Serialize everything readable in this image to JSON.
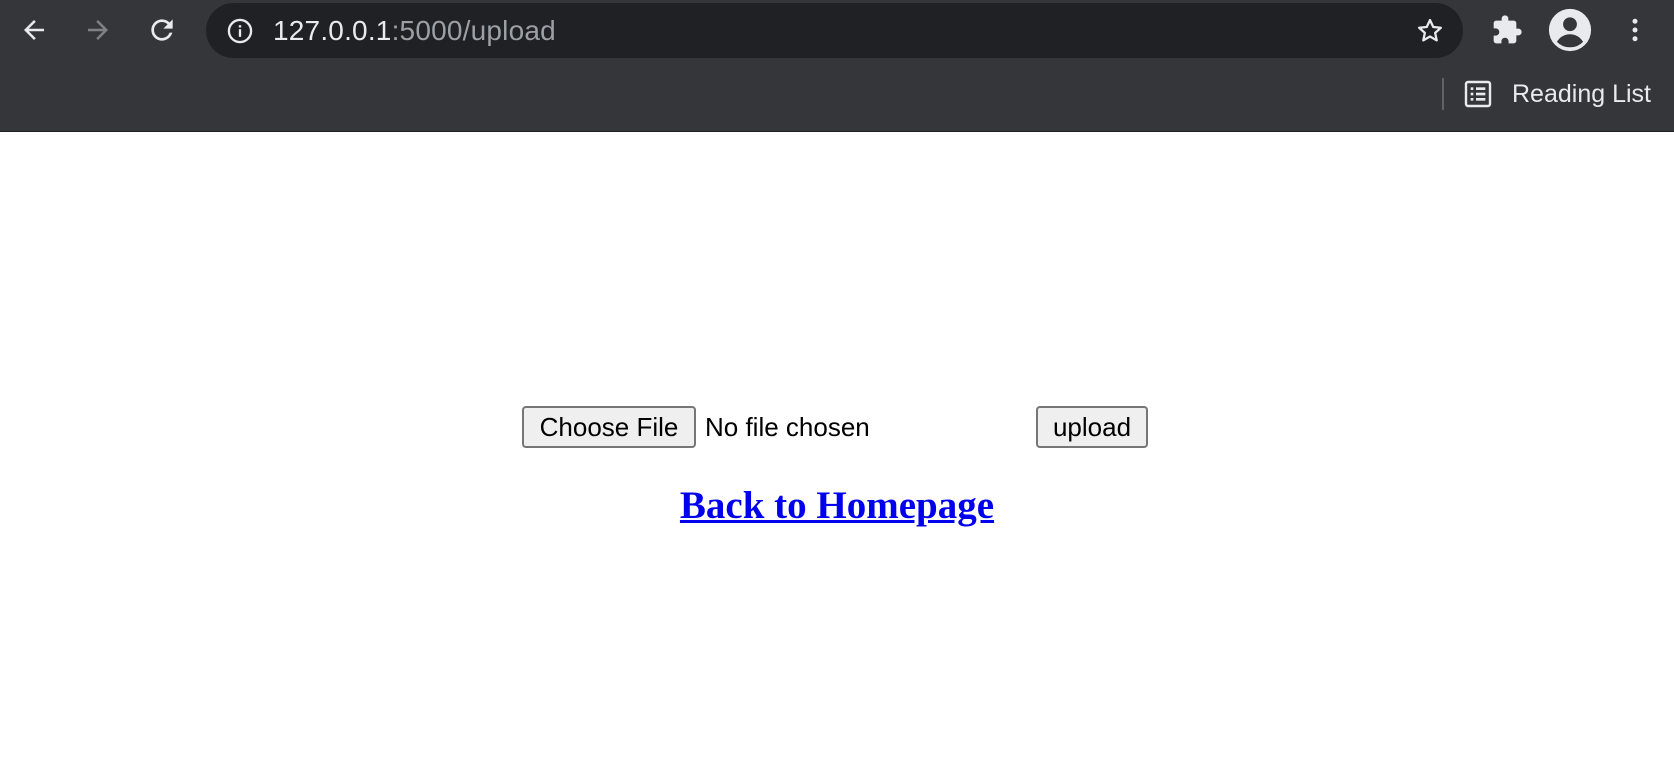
{
  "browser": {
    "url_host": "127.0.0.1",
    "url_path": ":5000/upload",
    "reading_list_label": "Reading List",
    "icons": {
      "back": "back-arrow-icon",
      "forward": "forward-arrow-icon",
      "reload": "reload-icon",
      "info": "info-icon",
      "bookmark": "star-icon",
      "extensions": "puzzle-icon",
      "profile": "profile-avatar-icon",
      "menu": "kebab-menu-icon",
      "reading_list": "reading-list-icon"
    },
    "colors": {
      "toolbar_bg": "#35363a",
      "omnibox_bg": "#202124",
      "host_text": "#e8eaed",
      "path_text": "#9aa0a6",
      "disabled_icon": "#7e8185"
    }
  },
  "page": {
    "choose_file_label": "Choose File",
    "file_status": "No file chosen",
    "upload_label": "upload",
    "back_link_label": "Back to Homepage",
    "colors": {
      "link": "#0000ee",
      "button_bg": "#efefef",
      "button_border": "#767676"
    }
  }
}
